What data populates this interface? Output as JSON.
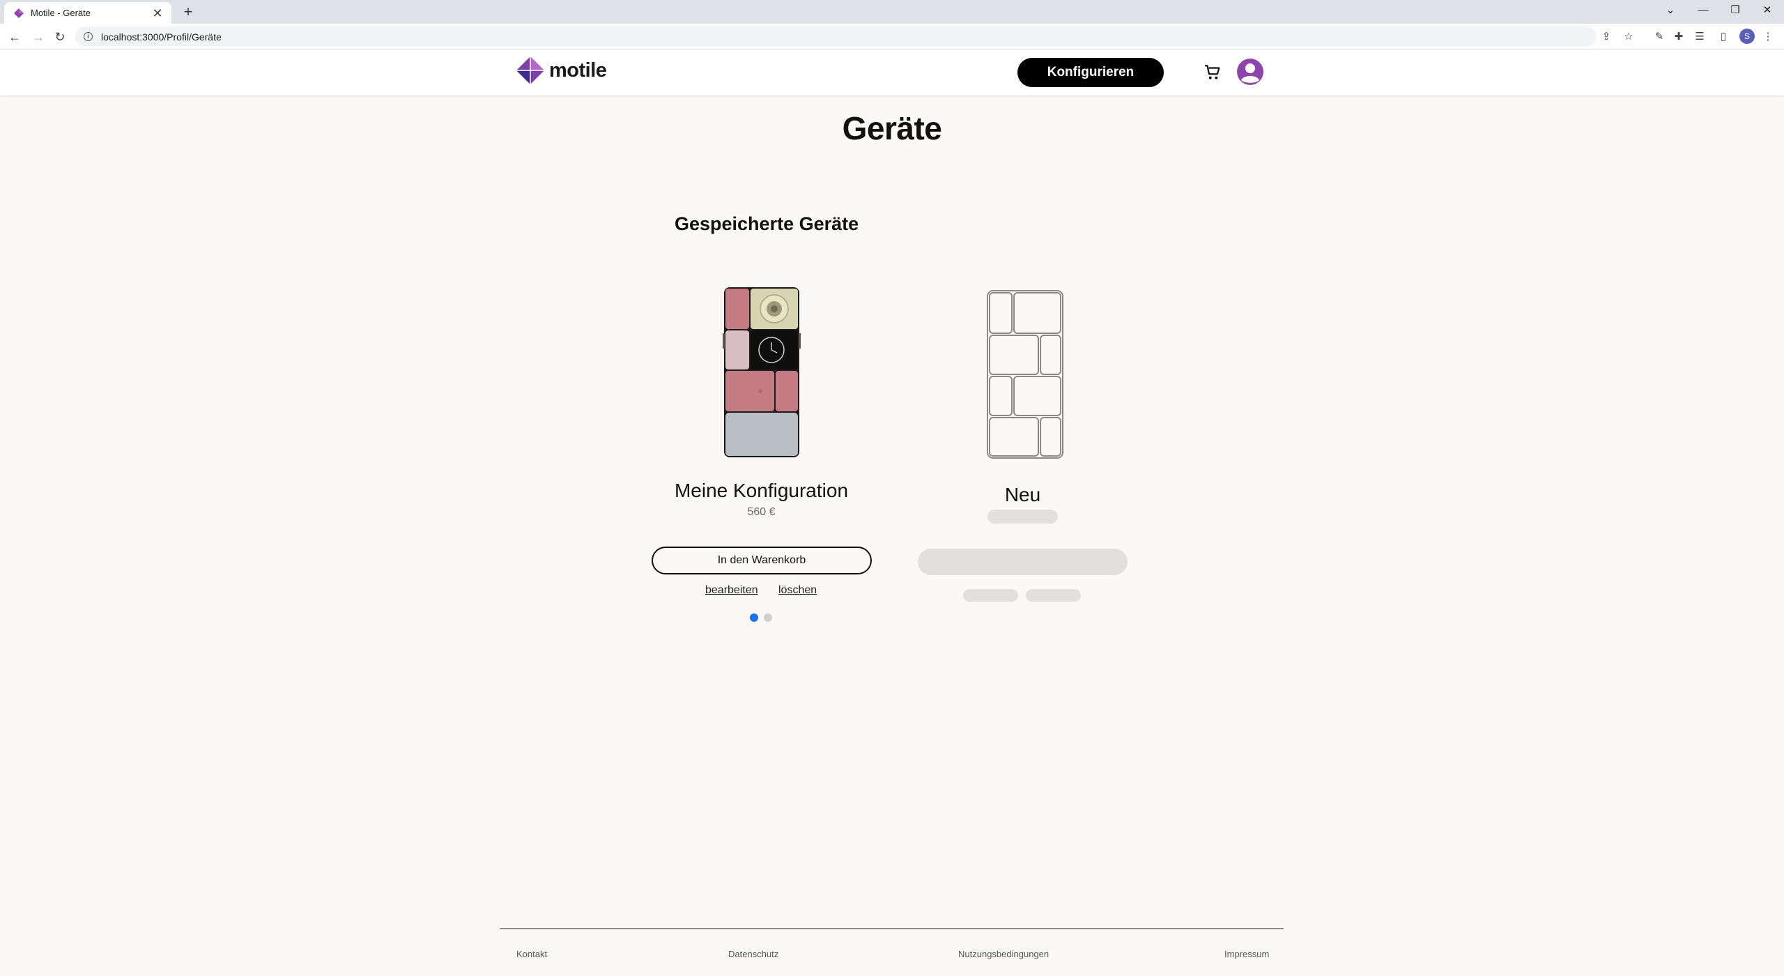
{
  "browser": {
    "tab_title": "Motile - Geräte",
    "tab_close": "✕",
    "new_tab": "+",
    "url": "localhost:3000/Profil/Geräte",
    "profile_initial": "S",
    "window_controls": {
      "dropdown": "⌄",
      "minimize": "—",
      "restore": "❐",
      "close": "✕"
    },
    "nav": {
      "back": "←",
      "forward": "→",
      "reload": "↻"
    }
  },
  "header": {
    "logo_text": "motile",
    "configure_label": "Konfigurieren"
  },
  "page": {
    "title": "Geräte",
    "section_title": "Gespeicherte Geräte"
  },
  "saved_device": {
    "name": "Meine Konfiguration",
    "price": "560 €",
    "cart_button": "In den Warenkorb",
    "edit_link": "bearbeiten",
    "delete_link": "löschen",
    "carousel": {
      "total": 2,
      "active": 1
    }
  },
  "new_device": {
    "name": "Neu"
  },
  "footer": {
    "links": [
      "Kontakt",
      "Datenschutz",
      "Nutzungsbedingungen",
      "Impressum"
    ]
  },
  "colors": {
    "accent_blue": "#1a73e8",
    "brand_purple": "#8e44ad",
    "module_pink": "#c57b83"
  }
}
